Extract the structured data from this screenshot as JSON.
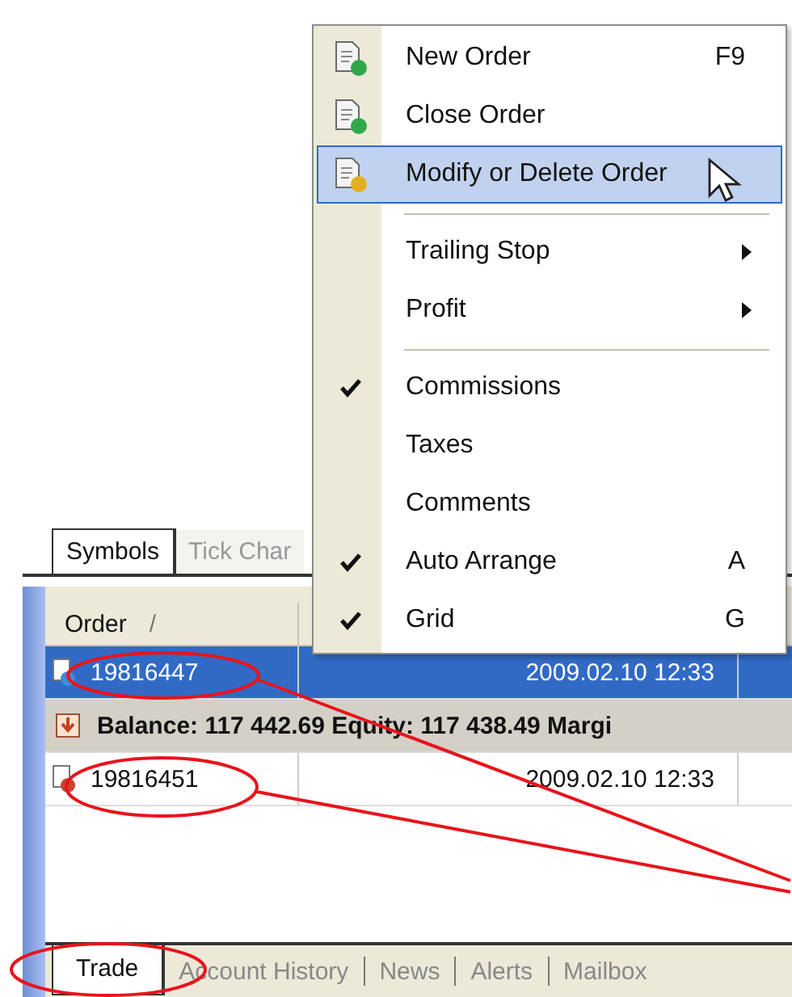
{
  "context_menu": {
    "items": [
      {
        "kind": "action",
        "label": "New Order",
        "shortcut": "F9",
        "selected": false
      },
      {
        "kind": "action",
        "label": "Close Order",
        "selected": false
      },
      {
        "kind": "action",
        "label": "Modify or Delete Order",
        "selected": true
      },
      {
        "kind": "separator"
      },
      {
        "kind": "submenu",
        "label": "Trailing Stop",
        "selected": false
      },
      {
        "kind": "submenu",
        "label": "Profit",
        "selected": false
      },
      {
        "kind": "separator"
      },
      {
        "kind": "check",
        "label": "Commissions",
        "checked": true,
        "selected": false
      },
      {
        "kind": "check",
        "label": "Taxes",
        "checked": false,
        "selected": false
      },
      {
        "kind": "check",
        "label": "Comments",
        "checked": false,
        "selected": false
      },
      {
        "kind": "check",
        "label": "Auto Arrange",
        "shortcut": "A",
        "checked": true,
        "selected": false
      },
      {
        "kind": "check",
        "label": "Grid",
        "shortcut": "G",
        "checked": true,
        "selected": false
      }
    ]
  },
  "chart_tabs": [
    {
      "label": "Symbols",
      "selected": true
    },
    {
      "label": "Tick Char",
      "selected": false
    }
  ],
  "terminal": {
    "columns": [
      {
        "label": "Order",
        "sort_mark": "/"
      }
    ],
    "rows": [
      {
        "kind": "order",
        "order": "19816447",
        "time": "2009.02.10 12:33",
        "color": "#3a8fd8",
        "selected": true
      },
      {
        "kind": "balance",
        "text": "Balance: 117 442.69  Equity: 117 438.49  Margi"
      },
      {
        "kind": "order",
        "order": "19816451",
        "time": "2009.02.10 12:33",
        "color": "#c8452c",
        "selected": false
      }
    ],
    "tabs": [
      {
        "label": "Trade",
        "selected": true
      },
      {
        "label": "Account History",
        "selected": false
      },
      {
        "label": "News",
        "selected": false
      },
      {
        "label": "Alerts",
        "selected": false
      },
      {
        "label": "Mailbox",
        "selected": false
      }
    ]
  }
}
